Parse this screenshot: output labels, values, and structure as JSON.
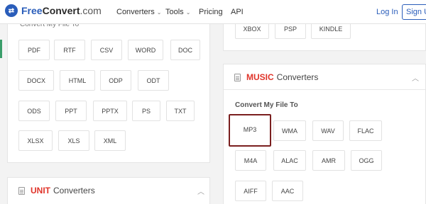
{
  "header": {
    "logo_icon": "freeconvert-logo-icon",
    "logo_free": "Free",
    "logo_convert": "Convert",
    "logo_tld": ".com",
    "nav": [
      {
        "label": "Converters",
        "has_caret": true
      },
      {
        "label": "Tools",
        "has_caret": true
      },
      {
        "label": "Pricing",
        "has_caret": false
      },
      {
        "label": "API",
        "has_caret": false
      }
    ],
    "login": "Log In",
    "signup": "Sign U"
  },
  "document_card": {
    "partial_label": "Convert My File To",
    "formats": [
      "PDF",
      "RTF",
      "CSV",
      "WORD",
      "DOC",
      "DOCX",
      "HTML",
      "ODP",
      "ODT",
      "ODS",
      "PPT",
      "PPTX",
      "PS",
      "TXT",
      "XLSX",
      "XLS",
      "XML"
    ]
  },
  "unit_card": {
    "highlight": "UNIT",
    "title": "Converters"
  },
  "ebook_card": {
    "formats": [
      "XBOX",
      "PSP",
      "KINDLE"
    ]
  },
  "music_card": {
    "highlight": "MUSIC",
    "title": "Converters",
    "label": "Convert My File To",
    "formats": [
      "MP3",
      "WMA",
      "WAV",
      "FLAC",
      "M4A",
      "ALAC",
      "AMR",
      "OGG",
      "AIFF",
      "AAC"
    ],
    "selected": "MP3"
  },
  "colors": {
    "brand_blue": "#2a5dba",
    "highlight_red": "#e0342a",
    "selected_border": "#7a1f1f",
    "accent_green": "#3a9d6a"
  }
}
